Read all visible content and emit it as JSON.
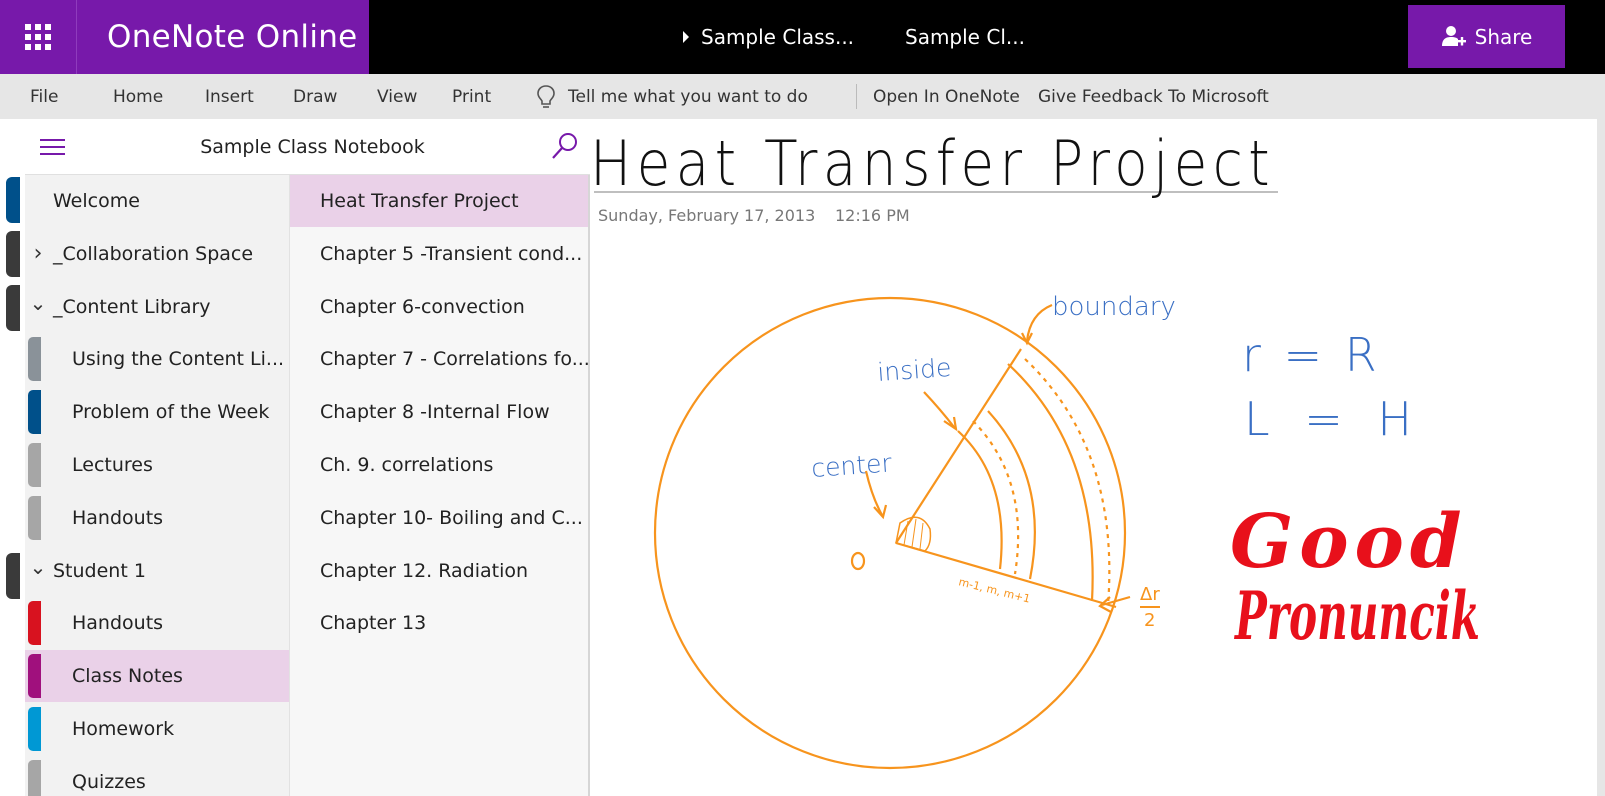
{
  "app": {
    "name": "OneNote Online",
    "breadcrumb_1": "Sample Class...",
    "breadcrumb_2": "Sample Cl...",
    "share_label": "Share"
  },
  "ribbon": {
    "items": [
      "File",
      "Home",
      "Insert",
      "Draw",
      "View",
      "Print"
    ],
    "tell_me": "Tell me what you want to do",
    "open_in": "Open In OneNote",
    "feedback": "Give Feedback To Microsoft"
  },
  "notebook": {
    "title": "Sample Class Notebook"
  },
  "sections": [
    {
      "label": "Welcome",
      "indent": 0,
      "chevron": "",
      "color": ""
    },
    {
      "label": "_Collaboration Space",
      "indent": 0,
      "chevron": "right",
      "color": ""
    },
    {
      "label": "_Content Library",
      "indent": 0,
      "chevron": "down",
      "color": ""
    },
    {
      "label": "Using the Content Li...",
      "indent": 1,
      "chevron": "",
      "color": "#8a9299"
    },
    {
      "label": "Problem of the Week",
      "indent": 1,
      "chevron": "",
      "color": "#00508a"
    },
    {
      "label": "Lectures",
      "indent": 1,
      "chevron": "",
      "color": "#a6a6a6"
    },
    {
      "label": "Handouts",
      "indent": 1,
      "chevron": "",
      "color": "#a6a6a6"
    },
    {
      "label": "Student 1",
      "indent": 0,
      "chevron": "down",
      "color": ""
    },
    {
      "label": "Handouts",
      "indent": 1,
      "chevron": "",
      "color": "#d8121f"
    },
    {
      "label": "Class Notes",
      "indent": 1,
      "chevron": "",
      "color": "#a0107d",
      "selected": true
    },
    {
      "label": "Homework",
      "indent": 1,
      "chevron": "",
      "color": "#0098d4"
    },
    {
      "label": "Quizzes",
      "indent": 1,
      "chevron": "",
      "color": "#a6a6a6"
    }
  ],
  "pages": [
    {
      "label": "Heat Transfer Project",
      "selected": true
    },
    {
      "label": "Chapter 5 -Transient cond..."
    },
    {
      "label": "Chapter 6-convection"
    },
    {
      "label": "Chapter 7 - Correlations fo..."
    },
    {
      "label": "Chapter 8 -Internal Flow"
    },
    {
      "label": "Ch. 9. correlations"
    },
    {
      "label": "Chapter 10- Boiling and C..."
    },
    {
      "label": "Chapter 12. Radiation"
    },
    {
      "label": "Chapter 13"
    }
  ],
  "page": {
    "title": "Heat Transfer Project",
    "date": "Sunday, February 17, 2013",
    "time": "12:16 PM",
    "ink": {
      "boundary": "boundary",
      "inside": "inside",
      "center": "center",
      "origin": "o",
      "nodes": "m-1, m, m+1",
      "dr_top": "Δr",
      "dr_bottom": "2",
      "eq1": "r = R",
      "eq2": "L = H",
      "good": "Good",
      "pron": "Pronuncik"
    }
  },
  "colors": {
    "brand": "#7719aa",
    "selected_bg": "#ead1e8",
    "ink_orange": "#f7941d",
    "ink_blue": "#3a6fc4",
    "ink_red": "#e8101b"
  }
}
